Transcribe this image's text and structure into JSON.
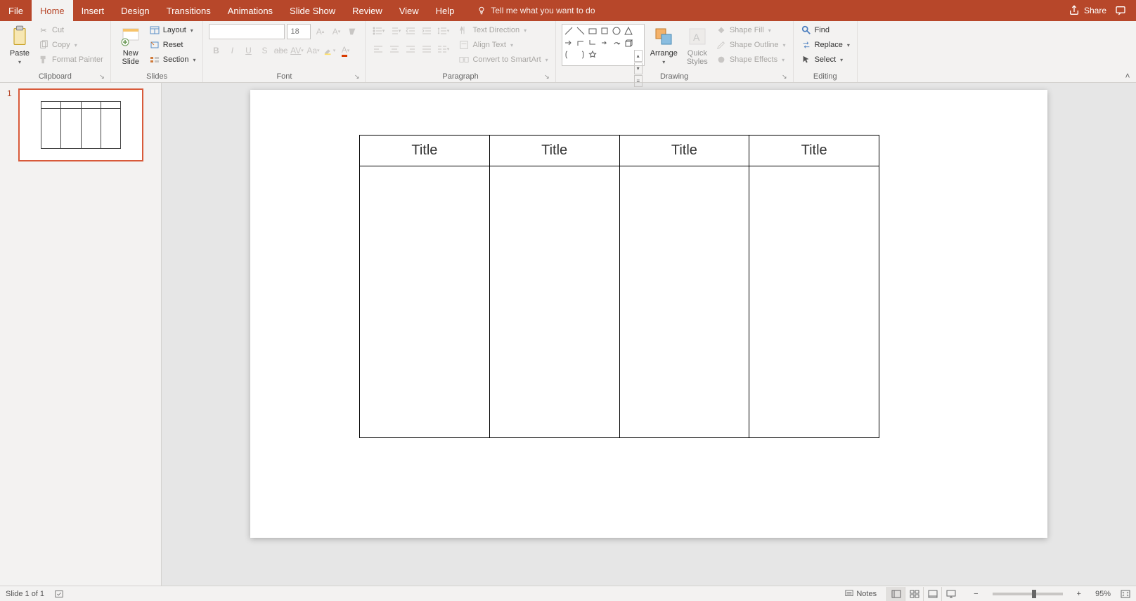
{
  "tabs": {
    "file": "File",
    "home": "Home",
    "insert": "Insert",
    "design": "Design",
    "transitions": "Transitions",
    "animations": "Animations",
    "slideshow": "Slide Show",
    "review": "Review",
    "view": "View",
    "help": "Help"
  },
  "tellme": "Tell me what you want to do",
  "share": "Share",
  "clipboard": {
    "paste": "Paste",
    "cut": "Cut",
    "copy": "Copy",
    "format_painter": "Format Painter",
    "label": "Clipboard"
  },
  "slides": {
    "new_slide": "New\nSlide",
    "layout": "Layout",
    "reset": "Reset",
    "section": "Section",
    "label": "Slides"
  },
  "font": {
    "size": "18",
    "label": "Font"
  },
  "paragraph": {
    "text_direction": "Text Direction",
    "align_text": "Align Text",
    "convert_smartart": "Convert to SmartArt",
    "label": "Paragraph"
  },
  "drawing": {
    "arrange": "Arrange",
    "quick_styles": "Quick\nStyles",
    "shape_fill": "Shape Fill",
    "shape_outline": "Shape Outline",
    "shape_effects": "Shape Effects",
    "label": "Drawing"
  },
  "editing": {
    "find": "Find",
    "replace": "Replace",
    "select": "Select",
    "label": "Editing"
  },
  "thumb": {
    "num": "1"
  },
  "table": {
    "c1": "Title",
    "c2": "Title",
    "c3": "Title",
    "c4": "Title"
  },
  "status": {
    "slide_of": "Slide 1 of 1",
    "notes": "Notes",
    "zoom": "95%"
  }
}
